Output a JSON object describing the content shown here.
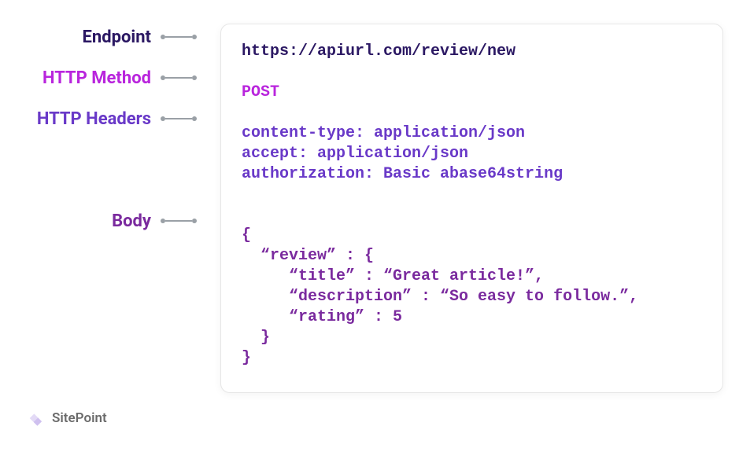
{
  "labels": {
    "endpoint": "Endpoint",
    "method": "HTTP Method",
    "headers": "HTTP Headers",
    "body": "Body"
  },
  "request": {
    "url": "https://apiurl.com/review/new",
    "method": "POST",
    "headers": {
      "line1": "content-type: application/json",
      "line2": "accept: application/json",
      "line3": "authorization: Basic abase64string"
    },
    "body_lines": {
      "l0": "{",
      "l1": "  “review” : {",
      "l2": "     “title” : “Great article!”,",
      "l3": "     “description” : “So easy to follow.”,",
      "l4": "     “rating” : 5",
      "l5": "  }",
      "l6": "}"
    }
  },
  "brand": {
    "name": "SitePoint"
  },
  "colors": {
    "endpoint": "#2b1863",
    "method": "#b925dd",
    "headers": "#6939c8",
    "body": "#7a2a9e",
    "connector": "#9aa0a6"
  }
}
